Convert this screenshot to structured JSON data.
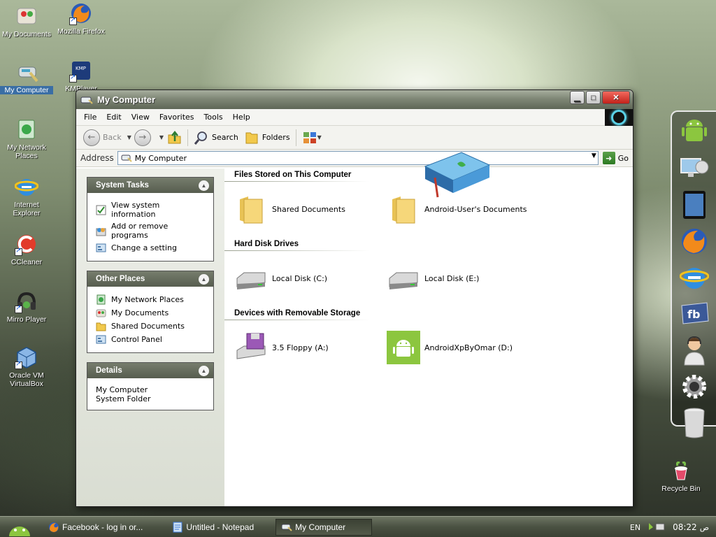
{
  "desktop": {
    "icons": [
      {
        "label": "My Documents"
      },
      {
        "label": "Mozilla Firefox"
      },
      {
        "label": "My Computer"
      },
      {
        "label": "KMPlayer"
      },
      {
        "label": "My Network Places"
      },
      {
        "label": "Internet Explorer"
      },
      {
        "label": "CCleaner"
      },
      {
        "label": "Mirro Player"
      },
      {
        "label": "Oracle VM VirtualBox"
      },
      {
        "label": "Recycle Bin"
      }
    ]
  },
  "window": {
    "title": "My Computer",
    "buttons": {
      "minimize": "▁",
      "maximize": "□",
      "close": "✕"
    },
    "menu": [
      "File",
      "Edit",
      "View",
      "Favorites",
      "Tools",
      "Help"
    ],
    "toolbar": {
      "back": "Back",
      "search": "Search",
      "folders": "Folders"
    },
    "address": {
      "label": "Address",
      "value": "My Computer",
      "go": "Go"
    }
  },
  "leftpane": {
    "system_tasks": {
      "title": "System Tasks",
      "items": [
        "View system information",
        "Add or remove programs",
        "Change a setting"
      ]
    },
    "other_places": {
      "title": "Other Places",
      "items": [
        "My Network Places",
        "My Documents",
        "Shared Documents",
        "Control Panel"
      ]
    },
    "details": {
      "title": "Details",
      "name": "My Computer",
      "type": "System Folder"
    }
  },
  "mainpane": {
    "groups": [
      {
        "title": "Files Stored on This Computer",
        "items": [
          "Shared Documents",
          "Android-User's Documents"
        ]
      },
      {
        "title": "Hard Disk Drives",
        "items": [
          "Local Disk (C:)",
          "Local Disk (E:)"
        ]
      },
      {
        "title": "Devices with Removable Storage",
        "items": [
          "3.5 Floppy (A:)",
          "AndroidXpByOmar (D:)"
        ]
      }
    ]
  },
  "taskbar": {
    "tasks": [
      "Facebook - log in or...",
      "Untitled - Notepad",
      "My Computer"
    ],
    "tray": {
      "lang": "EN",
      "time": "08:22",
      "ampm": "ص"
    }
  },
  "colors": {
    "accent": "#5f6757",
    "android_green": "#8cc63f",
    "selection": "#3a6ea5"
  }
}
